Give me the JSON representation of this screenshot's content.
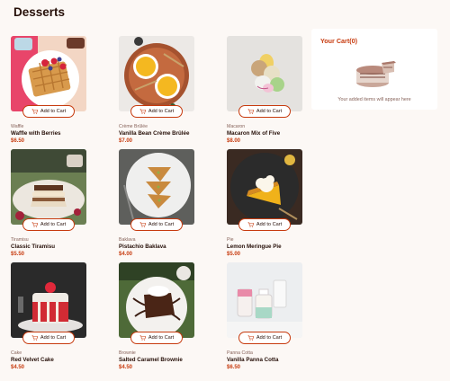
{
  "page": {
    "title": "Desserts"
  },
  "products": [
    {
      "category": "Waffle",
      "name": "Waffle with Berries",
      "price": "$6.50",
      "button": "Add to Cart",
      "image": "waffle-image"
    },
    {
      "category": "Crème Brûlée",
      "name": "Vanilla Bean Crème Brûlée",
      "price": "$7.00",
      "button": "Add to Cart",
      "image": "creme-brulee-image"
    },
    {
      "category": "Macaron",
      "name": "Macaron Mix of Five",
      "price": "$8.00",
      "button": "Add to Cart",
      "image": "macaron-image"
    },
    {
      "category": "Tiramisu",
      "name": "Classic Tiramisu",
      "price": "$5.50",
      "button": "Add to Cart",
      "image": "tiramisu-image"
    },
    {
      "category": "Baklava",
      "name": "Pistachio Baklava",
      "price": "$4.00",
      "button": "Add to Cart",
      "image": "baklava-image"
    },
    {
      "category": "Pie",
      "name": "Lemon Meringue Pie",
      "price": "$5.00",
      "button": "Add to Cart",
      "image": "pie-image"
    },
    {
      "category": "Cake",
      "name": "Red Velvet Cake",
      "price": "$4.50",
      "button": "Add to Cart",
      "image": "cake-image"
    },
    {
      "category": "Brownie",
      "name": "Salted Caramel Brownie",
      "price": "$4.50",
      "button": "Add to Cart",
      "image": "brownie-image"
    },
    {
      "category": "Panna Cotta",
      "name": "Vanilla Panna Cotta",
      "price": "$6.50",
      "button": "Add to Cart",
      "image": "panna-cotta-image"
    }
  ],
  "cart": {
    "title": "Your Cart(0)",
    "empty_message": "Your added items will appear here"
  },
  "colors": {
    "accent": "#c73b0f",
    "background": "#fcf8f5",
    "text": "#260f08",
    "muted": "#87635a"
  },
  "icons": {
    "add_to_cart": "cart-plus-icon"
  }
}
